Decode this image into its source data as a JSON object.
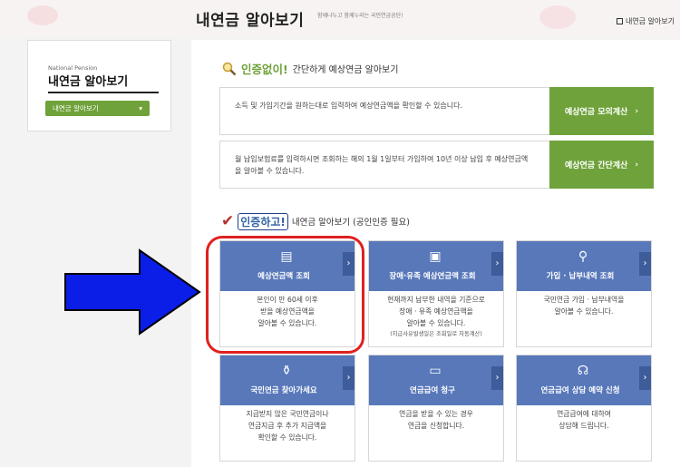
{
  "header": {
    "title": "내연금 알아보기",
    "subtitle": "함께나누고 함께누리는 국민연금공단!",
    "link_label": "내연금 알아보기"
  },
  "sidebar": {
    "en_label": "National Pension",
    "title": "내연금 알아보기",
    "select_value": "내연금 알아보기"
  },
  "section1": {
    "emphasis": "인증없이!",
    "rest": "간단하게 예상연금 알아보기",
    "items": [
      {
        "desc": "소득 및 가입기간을 원하는대로 입력하여 예상연금액을 확인할 수 있습니다.",
        "button": "예상연금 모의계산"
      },
      {
        "desc": "월 납입보험료를 입력하시면 조회하는 해의 1월 1일부터 가입하여 10년 이상 납입 후 예상연금액을 알아볼 수 있습니다.",
        "button": "예상연금 간단계산"
      }
    ]
  },
  "section2": {
    "emphasis": "인증하고!",
    "rest": "내연금 알아보기 (공인인증 필요)",
    "cards": [
      {
        "title": "예상연금액 조회",
        "lines": [
          "본인이 만 60세 이후",
          "받을 예상연금액을",
          "알아볼 수 있습니다."
        ],
        "note": ""
      },
      {
        "title": "장애·유족 예상연금액 조회",
        "lines": [
          "현재까지 납부한 내역을 기준으로",
          "장애 · 유족 예상연금액을",
          "알아볼 수 있습니다."
        ],
        "note": "(지급사유발생일은 조회일로 자동계산)"
      },
      {
        "title": "가입 · 납부내역 조회",
        "lines": [
          "국민연금 가입 · 납부내역을",
          "알아볼 수 있습니다."
        ],
        "note": ""
      },
      {
        "title": "국민연금 찾아가세요",
        "lines": [
          "지급받지 않은 국민연금이나",
          "연금지급 후 추가 지급액을",
          "확인할 수 있습니다."
        ],
        "note": ""
      },
      {
        "title": "연금급여 청구",
        "lines": [
          "연금을 받을 수 있는 경우",
          "연금을 신청합니다."
        ],
        "note": ""
      },
      {
        "title": "연금급여 상담 예약 신청",
        "lines": [
          "연금급여에 대하여",
          "상담해 드립니다."
        ],
        "note": ""
      }
    ]
  },
  "colors": {
    "green": "#6fa23a",
    "blue_card": "#5878ba",
    "annotation_red": "#e02020",
    "annotation_blue": "#0a1ee8"
  }
}
